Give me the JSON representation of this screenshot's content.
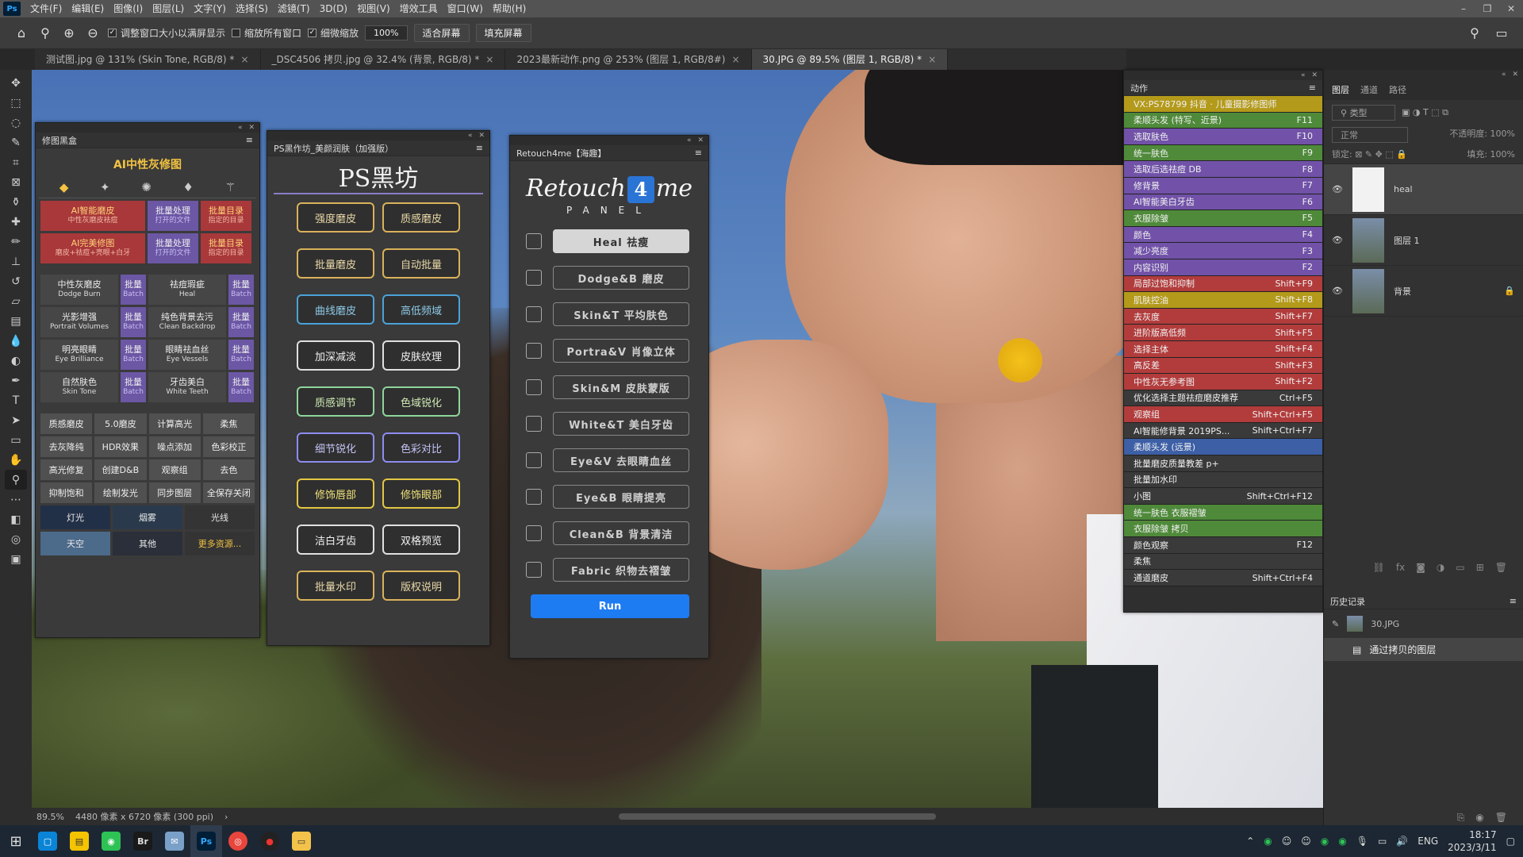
{
  "menubar": {
    "logo": "Ps",
    "items": [
      "文件(F)",
      "编辑(E)",
      "图像(I)",
      "图层(L)",
      "文字(Y)",
      "选择(S)",
      "滤镜(T)",
      "3D(D)",
      "视图(V)",
      "增效工具",
      "窗口(W)",
      "帮助(H)"
    ]
  },
  "options": {
    "check1": "调整窗口大小以满屏显示",
    "check2": "缩放所有窗口",
    "check3": "细微缩放",
    "zoom": "100%",
    "fit": "适合屏幕",
    "fill": "填充屏幕"
  },
  "tabs": [
    {
      "label": "测试图.jpg @ 131% (Skin Tone, RGB/8) *"
    },
    {
      "label": "_DSC4506 拷贝.jpg @ 32.4% (背景, RGB/8) *"
    },
    {
      "label": "2023最新动作.png @ 253% (图层 1, RGB/8#)"
    },
    {
      "label": "30.JPG @ 89.5% (图层 1, RGB/8) *"
    }
  ],
  "panel1": {
    "header": "修图黑盒",
    "title": "AI中性灰修图",
    "r1": [
      {
        "t": "AI智能磨皮",
        "s": "中性灰磨皮祛痘"
      },
      {
        "t": "批量处理",
        "s": "打开的文件"
      },
      {
        "t": "批量目录",
        "s": "指定的目录"
      }
    ],
    "r2": [
      {
        "t": "AI完美修图",
        "s": "磨皮+祛痘+亮眼+白牙"
      },
      {
        "t": "批量处理",
        "s": "打开的文件"
      },
      {
        "t": "批量目录",
        "s": "指定的目录"
      }
    ],
    "r3": [
      {
        "t": "中性灰磨皮",
        "s": "Dodge Burn"
      },
      {
        "t": "批量",
        "s": "Batch"
      },
      {
        "t": "祛痘瑕疵",
        "s": "Heal"
      },
      {
        "t": "批量",
        "s": "Batch"
      }
    ],
    "r4": [
      {
        "t": "光影增强",
        "s": "Portrait Volumes"
      },
      {
        "t": "批量",
        "s": "Batch"
      },
      {
        "t": "纯色背景去污",
        "s": "Clean Backdrop"
      },
      {
        "t": "批量",
        "s": "Batch"
      }
    ],
    "r5": [
      {
        "t": "明亮眼睛",
        "s": "Eye Brilliance"
      },
      {
        "t": "批量",
        "s": "Batch"
      },
      {
        "t": "眼睛祛血丝",
        "s": "Eye Vessels"
      },
      {
        "t": "批量",
        "s": "Batch"
      }
    ],
    "r6": [
      {
        "t": "自然肤色",
        "s": "Skin Tone"
      },
      {
        "t": "批量",
        "s": "Batch"
      },
      {
        "t": "牙齿美白",
        "s": "White Teeth"
      },
      {
        "t": "批量",
        "s": "Batch"
      }
    ],
    "g1": [
      "质感磨皮",
      "5.0磨皮",
      "计算高光",
      "柔焦"
    ],
    "g2": [
      "去灰降纯",
      "HDR效果",
      "噪点添加",
      "色彩校正"
    ],
    "g3": [
      "高光修复",
      "创建D&B",
      "观察组",
      "去色"
    ],
    "g4": [
      "抑制饱和",
      "绘制发光",
      "同步图层",
      "全保存关闭"
    ],
    "t1": [
      "灯光",
      "烟雾",
      "光线"
    ],
    "t2": [
      "天空",
      "其他",
      "更多资源..."
    ]
  },
  "panel2": {
    "header": "PS黑作坊_美颜润肤（加强版）",
    "logo": "PS黑坊",
    "rows": [
      [
        "强度磨皮",
        "质感磨皮"
      ],
      [
        "批量磨皮",
        "自动批量"
      ],
      [
        "曲线磨皮",
        "高低频域"
      ],
      [
        "加深减淡",
        "皮肤纹理"
      ],
      [
        "质感调节",
        "色域锐化"
      ],
      [
        "细节锐化",
        "色彩对比"
      ],
      [
        "修饰唇部",
        "修饰眼部"
      ],
      [
        "洁白牙齿",
        "双格预览"
      ],
      [
        "批量水印",
        "版权说明"
      ]
    ]
  },
  "panel3": {
    "header": "Retouch4me【海趣】",
    "logo_a": "Retouch",
    "logo_b": "4",
    "logo_c": "me",
    "logo_sub": "PANEL",
    "buttons": [
      "Heal 祛瘦",
      "Dodge&B 磨皮",
      "Skin&T 平均肤色",
      "Portra&V 肖像立体",
      "Skin&M 皮肤蒙版",
      "White&T 美白牙齿",
      "Eye&V 去眼睛血丝",
      "Eye&B 眼睛提亮",
      "Clean&B 背景清洁",
      "Fabric 织物去褶皱"
    ],
    "run": "Run"
  },
  "actions": {
    "title": "动作",
    "items": [
      {
        "n": "VX:PS78799 抖音 · 儿童摄影修图师",
        "k": "",
        "c": "olive"
      },
      {
        "n": "柔顺头发 (特写、近景)",
        "k": "F11",
        "c": "green"
      },
      {
        "n": "选取肤色",
        "k": "F10",
        "c": "violet"
      },
      {
        "n": "统一肤色",
        "k": "F9",
        "c": "green"
      },
      {
        "n": "选取后选祛痘 DB",
        "k": "F8",
        "c": "violet"
      },
      {
        "n": "修背景",
        "k": "F7",
        "c": "violet"
      },
      {
        "n": "AI智能美白牙齿",
        "k": "F6",
        "c": "violet"
      },
      {
        "n": "衣服除皱",
        "k": "F5",
        "c": "green"
      },
      {
        "n": "颜色",
        "k": "F4",
        "c": "violet"
      },
      {
        "n": "减少亮度",
        "k": "F3",
        "c": "violet"
      },
      {
        "n": "内容识别",
        "k": "F2",
        "c": "violet"
      },
      {
        "n": "局部过饱和抑制",
        "k": "Shift+F9",
        "c": "red"
      },
      {
        "n": "肌肤控油",
        "k": "Shift+F8",
        "c": "olive"
      },
      {
        "n": "去灰度",
        "k": "Shift+F7",
        "c": "red"
      },
      {
        "n": "进阶版高低频",
        "k": "Shift+F5",
        "c": "red"
      },
      {
        "n": "选择主体",
        "k": "Shift+F4",
        "c": "red"
      },
      {
        "n": "高反差",
        "k": "Shift+F3",
        "c": "red"
      },
      {
        "n": "中性灰无参考图",
        "k": "Shift+F2",
        "c": "red"
      },
      {
        "n": "优化选择主题祛痘磨皮推荐",
        "k": "Ctrl+F5",
        "c": "gray"
      },
      {
        "n": "观察组",
        "k": "Shift+Ctrl+F5",
        "c": "red"
      },
      {
        "n": "AI智能修背景 2019PS...",
        "k": "Shift+Ctrl+F7",
        "c": "gray"
      },
      {
        "n": "柔顺头发 (远景)",
        "k": "",
        "c": "blue"
      },
      {
        "n": "批量磨皮质量教差 p+",
        "k": "",
        "c": "gray"
      },
      {
        "n": "批量加水印",
        "k": "",
        "c": "gray"
      },
      {
        "n": "小图",
        "k": "Shift+Ctrl+F12",
        "c": "gray"
      },
      {
        "n": "统一肤色 衣服褶皱",
        "k": "",
        "c": "green"
      },
      {
        "n": "衣服除皱 拷贝",
        "k": "",
        "c": "green"
      },
      {
        "n": "颜色观察",
        "k": "F12",
        "c": "gray"
      },
      {
        "n": "柔焦",
        "k": "",
        "c": "gray"
      },
      {
        "n": "通道磨皮",
        "k": "Shift+Ctrl+F4",
        "c": "gray"
      }
    ]
  },
  "layers": {
    "tabs": [
      "图层",
      "通道",
      "路径"
    ],
    "search": "类型",
    "blend": "正常",
    "opacity_label": "不透明度:",
    "opacity": "100%",
    "lock_label": "锁定:",
    "fill_label": "填充:",
    "fill": "100%",
    "items": [
      {
        "name": "heal"
      },
      {
        "name": "图层 1"
      },
      {
        "name": "背景"
      }
    ]
  },
  "history": {
    "title": "历史记录",
    "items": [
      "30.JPG",
      "通过拷贝的图层"
    ]
  },
  "status": {
    "zoom": "89.5%",
    "info": "4480 像素 x 6720 像素 (300 ppi)"
  },
  "taskbar": {
    "lang": "ENG",
    "time": "18:17",
    "date": "2023/3/11",
    "br": "Br",
    "ps": "Ps"
  }
}
